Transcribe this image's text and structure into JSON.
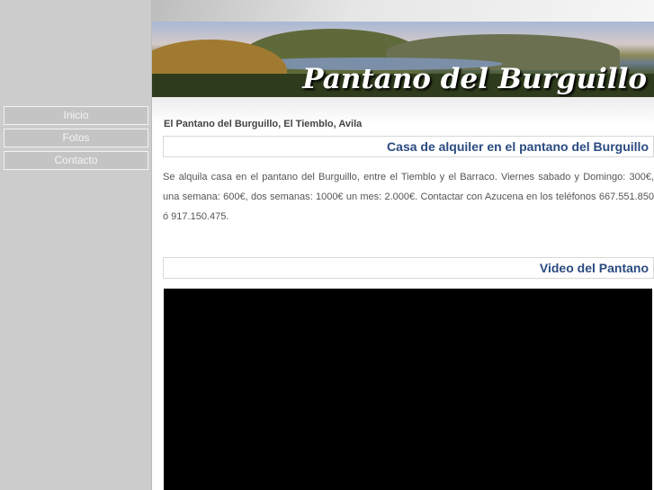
{
  "nav": [
    {
      "label": "Inicio"
    },
    {
      "label": "Fotos"
    },
    {
      "label": "Contacto"
    }
  ],
  "banner": {
    "title": "Pantano del Burguillo"
  },
  "breadcrumb": "El Pantano del Burguillo, El Tiemblo, Avila",
  "section1": {
    "heading": "Casa de alquiler en el pantano del Burguillo",
    "text": "Se alquila casa en el pantano del Burguillo, entre el Tiemblo y el Barraco. Viernes sabado y Domingo: 300€, una semana: 600€, dos semanas: 1000€ un mes: 2.000€. Contactar con Azucena en los teléfonos 667.551.850 ó 917.150.475."
  },
  "section2": {
    "heading": "Video del Pantano"
  }
}
